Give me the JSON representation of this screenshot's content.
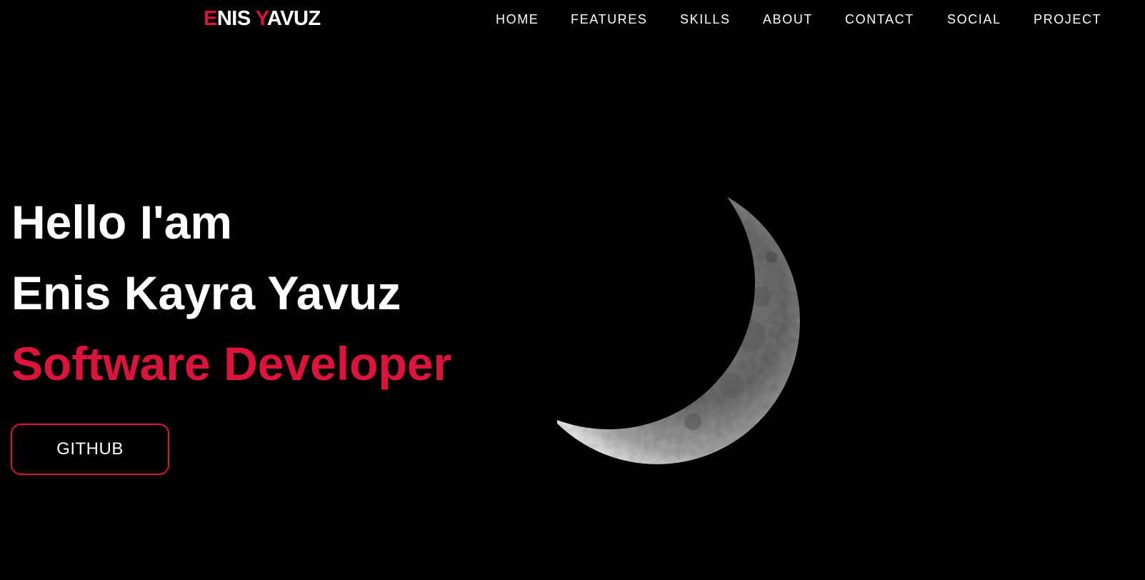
{
  "logo": {
    "first_initial": "E",
    "first_rest": "NIS",
    "second_initial": "Y",
    "second_rest": "AVUZ"
  },
  "nav": {
    "items": [
      {
        "label": "HOME"
      },
      {
        "label": "FEATURES"
      },
      {
        "label": "SKILLS"
      },
      {
        "label": "ABOUT"
      },
      {
        "label": "CONTACT"
      },
      {
        "label": "SOCIAL"
      },
      {
        "label": "PROJECT"
      }
    ]
  },
  "hero": {
    "greeting": "Hello I'am",
    "name": "Enis Kayra Yavuz",
    "role": "Software Developer",
    "button_label": "GITHUB"
  },
  "colors": {
    "background": "#000000",
    "accent": "#dc143c",
    "text": "#ffffff"
  }
}
